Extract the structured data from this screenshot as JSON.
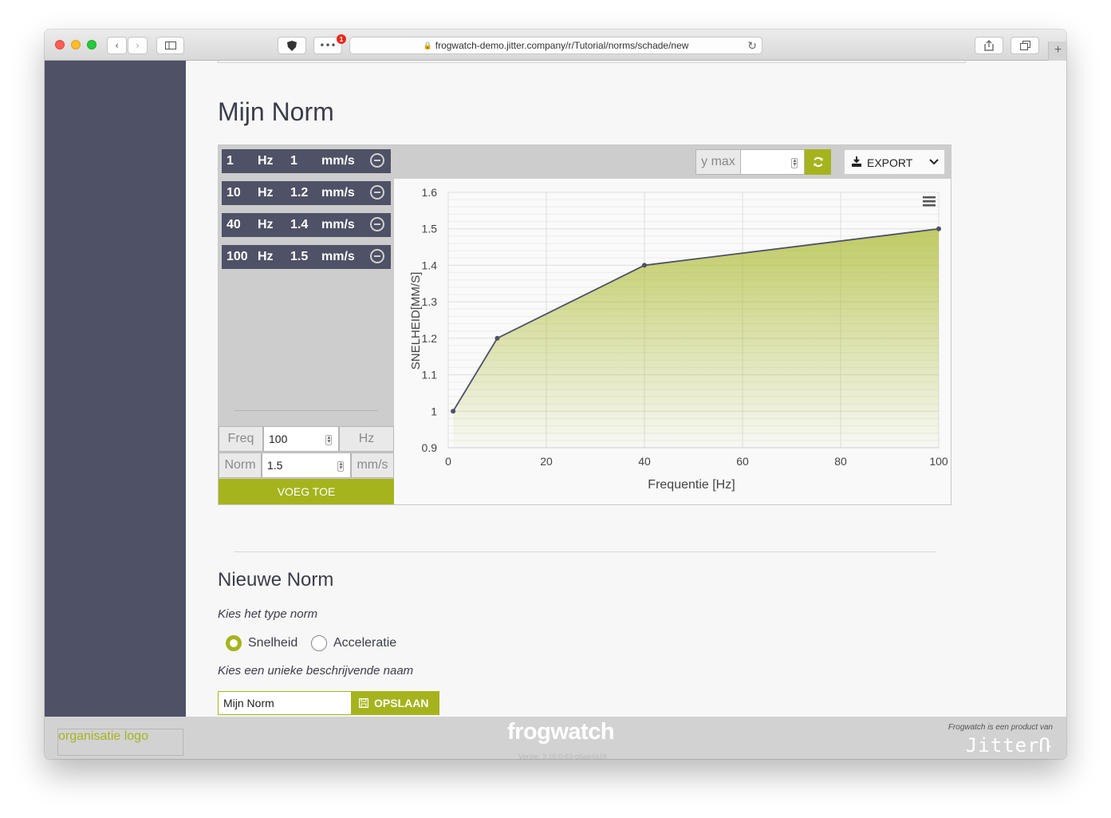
{
  "browser": {
    "url": "frogwatch-demo.jitter.company/r/Tutorial/norms/schade/new",
    "badge_count": "1"
  },
  "page": {
    "title": "Mijn Norm"
  },
  "norm_list": [
    {
      "freq": "1",
      "freq_unit": "Hz",
      "value": "1",
      "value_unit": "mm/s"
    },
    {
      "freq": "10",
      "freq_unit": "Hz",
      "value": "1.2",
      "value_unit": "mm/s"
    },
    {
      "freq": "40",
      "freq_unit": "Hz",
      "value": "1.4",
      "value_unit": "mm/s"
    },
    {
      "freq": "100",
      "freq_unit": "Hz",
      "value": "1.5",
      "value_unit": "mm/s"
    }
  ],
  "add_form": {
    "freq_label": "Freq",
    "freq_value": "100",
    "freq_unit": "Hz",
    "norm_label": "Norm",
    "norm_value": "1.5",
    "norm_unit": "mm/s",
    "add_button": "VOEG TOE"
  },
  "chart_toolbar": {
    "ymax_label": "y max",
    "ymax_value": "",
    "export_label": "EXPORT"
  },
  "chart_data": {
    "type": "area",
    "x": [
      1,
      10,
      40,
      100
    ],
    "y": [
      1,
      1.2,
      1.4,
      1.5
    ],
    "xlabel": "Frequentie [Hz]",
    "ylabel": "SNELHEID[MM/S]",
    "xlim": [
      0,
      100
    ],
    "ylim": [
      0.9,
      1.6
    ],
    "xticks": [
      "0",
      "20",
      "40",
      "60",
      "80",
      "100"
    ],
    "yticks": [
      "0.9",
      "1",
      "1.1",
      "1.2",
      "1.3",
      "1.4",
      "1.5",
      "1.6"
    ],
    "grid": true,
    "line_color": "#4f5167",
    "fill_color": "#a5b41d"
  },
  "new_norm": {
    "heading": "Nieuwe Norm",
    "type_prompt": "Kies het type norm",
    "option_speed": "Snelheid",
    "option_accel": "Acceleratie",
    "selected": "Snelheid",
    "name_prompt": "Kies een unieke beschrijvende naam",
    "name_value": "Mijn Norm",
    "save_button": "OPSLAAN"
  },
  "footer": {
    "org_logo": "organisatie logo",
    "brand": "frogwatch",
    "version": "Versie: 3.10.0-63-g6ae4a16",
    "product_of": "Frogwatch is een product van",
    "company": "JitterՌ"
  },
  "colors": {
    "accent": "#a5b41d",
    "sidebar": "#4f5167"
  }
}
